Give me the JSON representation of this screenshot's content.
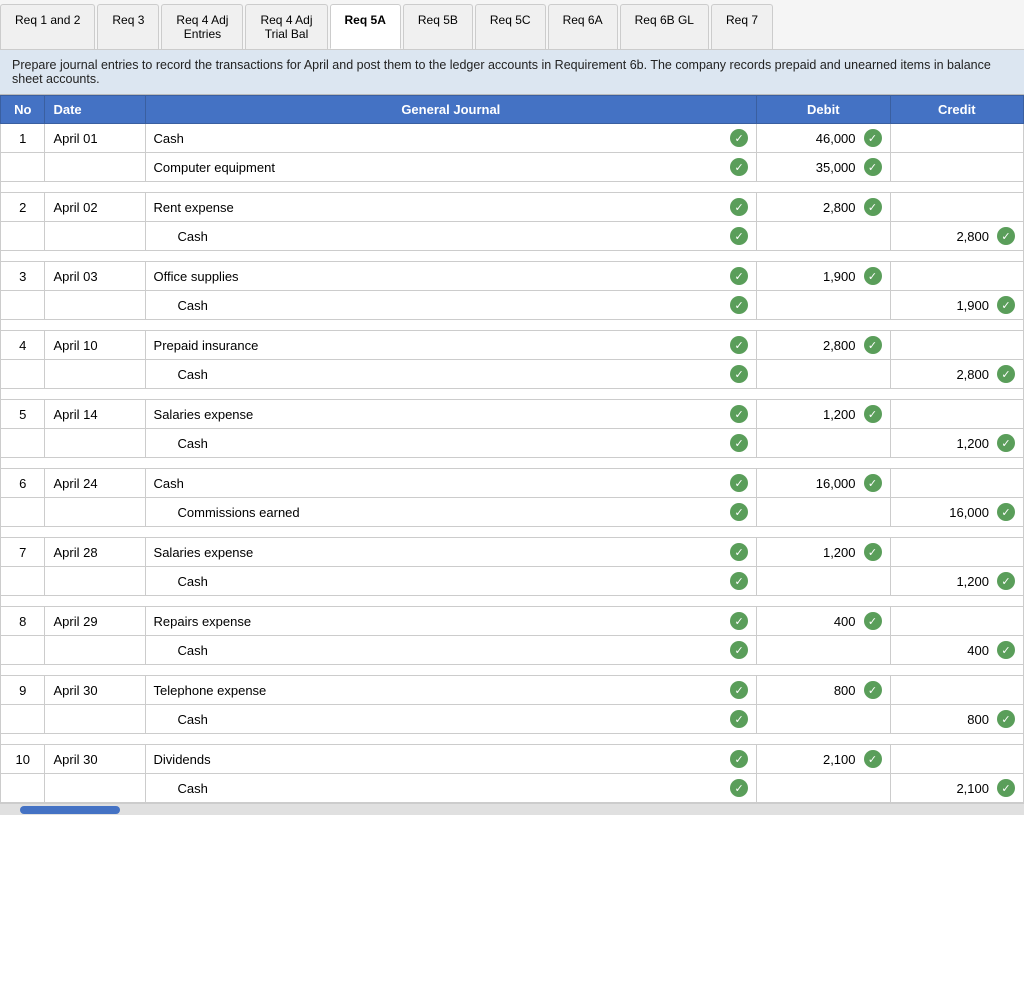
{
  "tabs": [
    {
      "label": "Req 1 and 2",
      "active": false
    },
    {
      "label": "Req 3",
      "active": false
    },
    {
      "label": "Req 4 Adj\nEntries",
      "active": false
    },
    {
      "label": "Req 4 Adj\nTrial Bal",
      "active": false
    },
    {
      "label": "Req 5A",
      "active": false
    },
    {
      "label": "Req 5B",
      "active": false
    },
    {
      "label": "Req 5C",
      "active": false
    },
    {
      "label": "Req 6A",
      "active": false
    },
    {
      "label": "Req 6B GL",
      "active": false
    },
    {
      "label": "Req 7",
      "active": false
    }
  ],
  "description": "Prepare journal entries to record the transactions for April and post them to the ledger accounts in Requirement 6b. The company records prepaid and unearned items in balance sheet accounts.",
  "table": {
    "headers": {
      "no": "No",
      "date": "Date",
      "journal": "General Journal",
      "debit": "Debit",
      "credit": "Credit"
    },
    "entries": [
      {
        "no": "1",
        "rows": [
          {
            "date": "April 01",
            "account": "Cash",
            "indented": false,
            "debit": "46,000",
            "credit": ""
          },
          {
            "date": "",
            "account": "Computer equipment",
            "indented": false,
            "debit": "35,000",
            "credit": ""
          }
        ]
      },
      {
        "no": "2",
        "rows": [
          {
            "date": "April 02",
            "account": "Rent expense",
            "indented": false,
            "debit": "2,800",
            "credit": ""
          },
          {
            "date": "",
            "account": "Cash",
            "indented": true,
            "debit": "",
            "credit": "2,800"
          }
        ]
      },
      {
        "no": "3",
        "rows": [
          {
            "date": "April 03",
            "account": "Office supplies",
            "indented": false,
            "debit": "1,900",
            "credit": ""
          },
          {
            "date": "",
            "account": "Cash",
            "indented": true,
            "debit": "",
            "credit": "1,900"
          }
        ]
      },
      {
        "no": "4",
        "rows": [
          {
            "date": "April 10",
            "account": "Prepaid insurance",
            "indented": false,
            "debit": "2,800",
            "credit": ""
          },
          {
            "date": "",
            "account": "Cash",
            "indented": true,
            "debit": "",
            "credit": "2,800"
          }
        ]
      },
      {
        "no": "5",
        "rows": [
          {
            "date": "April 14",
            "account": "Salaries expense",
            "indented": false,
            "debit": "1,200",
            "credit": ""
          },
          {
            "date": "",
            "account": "Cash",
            "indented": true,
            "debit": "",
            "credit": "1,200"
          }
        ]
      },
      {
        "no": "6",
        "rows": [
          {
            "date": "April 24",
            "account": "Cash",
            "indented": false,
            "debit": "16,000",
            "credit": ""
          },
          {
            "date": "",
            "account": "Commissions earned",
            "indented": true,
            "debit": "",
            "credit": "16,000"
          }
        ]
      },
      {
        "no": "7",
        "rows": [
          {
            "date": "April 28",
            "account": "Salaries expense",
            "indented": false,
            "debit": "1,200",
            "credit": ""
          },
          {
            "date": "",
            "account": "Cash",
            "indented": true,
            "debit": "",
            "credit": "1,200"
          }
        ]
      },
      {
        "no": "8",
        "rows": [
          {
            "date": "April 29",
            "account": "Repairs expense",
            "indented": false,
            "debit": "400",
            "credit": ""
          },
          {
            "date": "",
            "account": "Cash",
            "indented": true,
            "debit": "",
            "credit": "400"
          }
        ]
      },
      {
        "no": "9",
        "rows": [
          {
            "date": "April 30",
            "account": "Telephone expense",
            "indented": false,
            "debit": "800",
            "credit": ""
          },
          {
            "date": "",
            "account": "Cash",
            "indented": true,
            "debit": "",
            "credit": "800"
          }
        ]
      },
      {
        "no": "10",
        "rows": [
          {
            "date": "April 30",
            "account": "Dividends",
            "indented": false,
            "debit": "2,100",
            "credit": ""
          },
          {
            "date": "",
            "account": "Cash",
            "indented": true,
            "debit": "",
            "credit": "2,100"
          }
        ]
      }
    ]
  }
}
